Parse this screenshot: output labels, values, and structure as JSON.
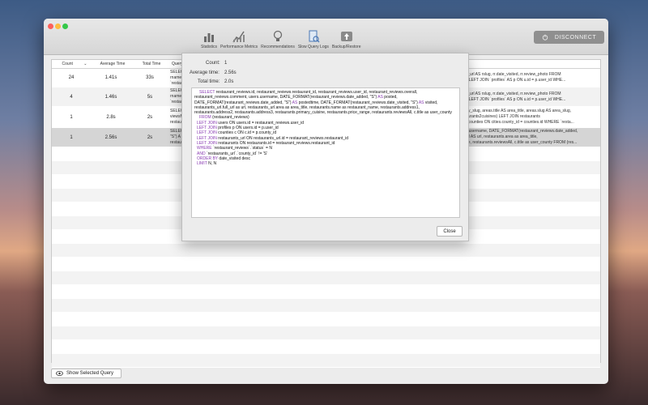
{
  "toolbar": {
    "items": [
      {
        "label": "Statistics",
        "icon": "bar-chart-icon"
      },
      {
        "label": "Performance Metrics",
        "icon": "metrics-icon"
      },
      {
        "label": "Recommendations",
        "icon": "lightbulb-icon"
      },
      {
        "label": "Slow Query Logs",
        "icon": "logs-icon"
      },
      {
        "label": "Backup/Restore",
        "icon": "backup-icon"
      }
    ],
    "disconnect_label": "DISCONNECT"
  },
  "table": {
    "headers": {
      "count": "Count",
      "avg": "Average Time",
      "total": "Total Time",
      "query": "Query"
    },
    "rows": [
      {
        "count": "24",
        "avg": "1.41s",
        "total": "33s",
        "q1": "SELECT",
        "q2": "rname,",
        "q3": "`restau",
        "r1": "r2.full_url AS rslug, rr.date_visited, rr.review_photo FROM",
        "r2": "= u.id LEFT JOIN `profiles` AS p ON u.id = p.user_id WHE..."
      },
      {
        "count": "4",
        "avg": "1.46s",
        "total": "5s",
        "q1": "SELEC",
        "q2": "rname,",
        "q3": "`restau",
        "r1": "r2.full_url AS rslug, rr.date_visited, rr.review_photo FROM",
        "r2": "= u.id LEFT JOIN `profiles` AS p ON u.id = p.user_id WHE..."
      },
      {
        "count": "1",
        "avg": "2.8s",
        "total": "2s",
        "q1": "SELECT",
        "q2": "viewsM",
        "q3": "restaur",
        "r1": "AS city_slug, areas.title AS area_title, areas.slug AS area_slug,",
        "r2": "(restaurants2cuisines) LEFT JOIN restaurants",
        "r3": "JOIN counties ON cities.county_id = counties.id WHERE `resta..."
      },
      {
        "count": "1",
        "avg": "2.56s",
        "total": "2s",
        "q1": "SELEC",
        "q2": "\"S\") A",
        "q3": "restaur",
        "r1": "users.username, DATE_FORMAT(restaurant_reviews.date_added,",
        "r2": "full_url AS url, restaurants.area as area_title,",
        "r3": "_range, restaurants.reviewsAll, c.title as user_county FROM (res..."
      }
    ]
  },
  "show_selected_label": "Show Selected Query",
  "details": {
    "count_label": "Count:",
    "count_value": "1",
    "avg_label": "Average time:",
    "avg_value": "2.56s",
    "total_label": "Total time:",
    "total_value": "2.0s",
    "sql_1a": "SELECT",
    "sql_1b": " restaurant_reviews.id, restaurant_reviews.restaurant_id, restaurant_reviews.user_id, restaurant_reviews.overall, restaurant_reviews.comment, users.username, DATE_FORMAT(restaurant_reviews.date_added, \"S\") ",
    "sql_1c": "AS",
    "sql_1d": " posted, DATE_FORMAT(restaurant_reviews.date_added, \"S\") ",
    "sql_1e": "AS",
    "sql_1f": " postedtime, DATE_FORMAT(restaurant_reviews.date_visited, \"S\") ",
    "sql_1g": "AS",
    "sql_1h": " visited, restaurants_url.full_url as url, restaurants_url.area as area_title, restaurants.name as restaurant_name, restaurants.address1, restaurants.address2, restaurants.address3, restaurants.primary_cuisine, restaurants.price_range, restaurants.reviewsAll, c.title as user_county",
    "sql_2k": "FROM",
    "sql_2v": " (restaurant_reviews)",
    "sql_3k": "LEFT JOIN",
    "sql_3v": " users ON users.id = restaurant_reviews.user_id",
    "sql_4k": "LEFT JOIN",
    "sql_4v": " profiles p ON users.id = p.user_id",
    "sql_5k": "LEFT JOIN",
    "sql_5v": " counties c ON c.id = p.county_id",
    "sql_6k": "LEFT JOIN",
    "sql_6v": " restaurants_url ON restaurants_url.id = restaurant_reviews.restaurant_id",
    "sql_7k": "LEFT JOIN",
    "sql_7v": " restaurants ON restaurants.id = restaurant_reviews.restaurant_id",
    "sql_8k": "WHERE",
    "sql_8v": " `restaurant_reviews`.`status` = N",
    "sql_9k": "AND",
    "sql_9v": " `restaurants_url`.`county_id` != 'S'",
    "sql_10k": "ORDER BY",
    "sql_10v": " date_visited desc",
    "sql_11k": "LIMIT",
    "sql_11v": " N, N",
    "close_label": "Close"
  }
}
